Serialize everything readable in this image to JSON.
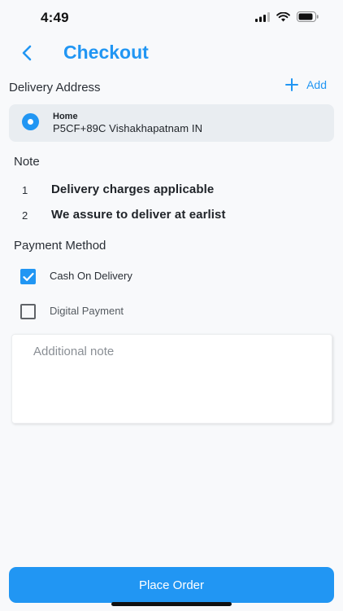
{
  "status_bar": {
    "time": "4:49",
    "icons": [
      "signal-icon",
      "wifi-icon",
      "battery-icon"
    ]
  },
  "header": {
    "back_icon": "chevron-left-icon",
    "title": "Checkout"
  },
  "delivery": {
    "label": "Delivery Address",
    "add_label": "Add",
    "address": {
      "name": "Home",
      "line": "P5CF+89C Vishakhapatnam IN",
      "selected": true
    }
  },
  "note": {
    "label": "Note",
    "items": [
      {
        "number": "1",
        "text": "Delivery charges applicable"
      },
      {
        "number": "2",
        "text": "We assure to deliver at earlist"
      }
    ]
  },
  "payment": {
    "label": "Payment Method",
    "options": [
      {
        "label": "Cash On Delivery",
        "checked": true
      },
      {
        "label": "Digital Payment",
        "checked": false
      }
    ]
  },
  "additional_note": {
    "placeholder": "Additional note",
    "value": ""
  },
  "actions": {
    "place_order_label": "Place Order"
  },
  "colors": {
    "accent": "#2196f3",
    "card_bg": "#e9edf1",
    "page_bg": "#f8f9fb"
  }
}
